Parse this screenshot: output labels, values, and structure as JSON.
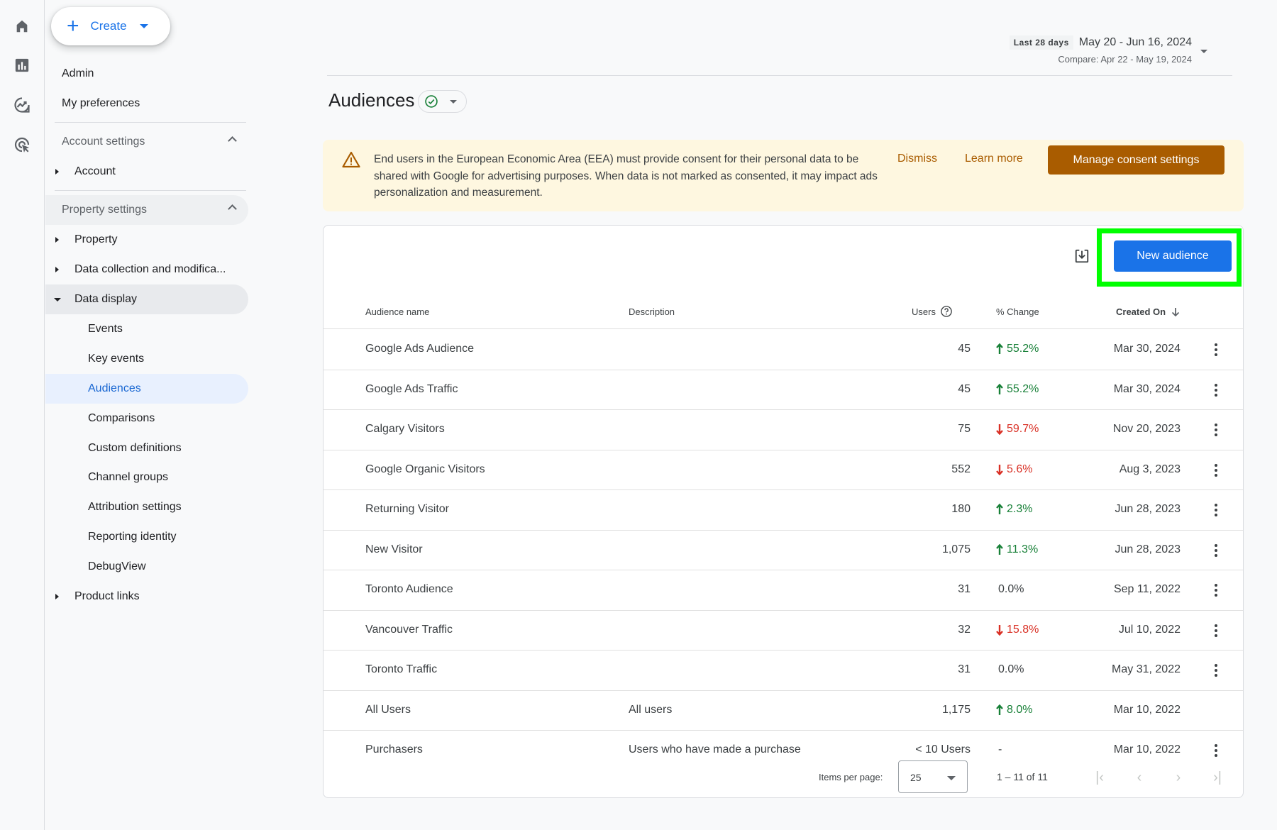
{
  "rail": {
    "icons": [
      "home-icon",
      "reports-icon",
      "explore-icon",
      "advertising-icon"
    ]
  },
  "nav": {
    "create_label": "Create",
    "admin": "Admin",
    "my_preferences": "My preferences",
    "account_settings": "Account settings",
    "account": "Account",
    "property_settings": "Property settings",
    "property": "Property",
    "data_collection": "Data collection and modifica...",
    "data_display": "Data display",
    "events": "Events",
    "key_events": "Key events",
    "audiences": "Audiences",
    "comparisons": "Comparisons",
    "custom_definitions": "Custom definitions",
    "channel_groups": "Channel groups",
    "attribution_settings": "Attribution settings",
    "reporting_identity": "Reporting identity",
    "debugview": "DebugView",
    "product_links": "Product links"
  },
  "date_range": {
    "preset": "Last 28 days",
    "range": "May 20 - Jun 16, 2024",
    "compare": "Compare: Apr 22 - May 19, 2024"
  },
  "page": {
    "title": "Audiences"
  },
  "banner": {
    "message": "End users in the European Economic Area (EEA) must provide consent for their personal data to be shared with Google for advertising purposes. When data is not marked as consented, it may impact ads personalization and measurement.",
    "dismiss": "Dismiss",
    "learn_more": "Learn more",
    "manage": "Manage consent settings"
  },
  "table": {
    "new_audience": "New audience",
    "columns": {
      "name": "Audience name",
      "description": "Description",
      "users": "Users",
      "change": "% Change",
      "created": "Created On"
    },
    "rows": [
      {
        "name": "Google Ads Audience",
        "description": "",
        "users": "45",
        "change": "55.2%",
        "trend": "up",
        "created": "Mar 30, 2024",
        "menu": true
      },
      {
        "name": "Google Ads Traffic",
        "description": "",
        "users": "45",
        "change": "55.2%",
        "trend": "up",
        "created": "Mar 30, 2024",
        "menu": true
      },
      {
        "name": "Calgary Visitors",
        "description": "",
        "users": "75",
        "change": "59.7%",
        "trend": "down",
        "created": "Nov 20, 2023",
        "menu": true
      },
      {
        "name": "Google Organic Visitors",
        "description": "",
        "users": "552",
        "change": "5.6%",
        "trend": "down",
        "created": "Aug 3, 2023",
        "menu": true
      },
      {
        "name": "Returning Visitor",
        "description": "",
        "users": "180",
        "change": "2.3%",
        "trend": "up",
        "created": "Jun 28, 2023",
        "menu": true
      },
      {
        "name": "New Visitor",
        "description": "",
        "users": "1,075",
        "change": "11.3%",
        "trend": "up",
        "created": "Jun 28, 2023",
        "menu": true
      },
      {
        "name": "Toronto Audience",
        "description": "",
        "users": "31",
        "change": "0.0%",
        "trend": "flat",
        "created": "Sep 11, 2022",
        "menu": true
      },
      {
        "name": "Vancouver Traffic",
        "description": "",
        "users": "32",
        "change": "15.8%",
        "trend": "down",
        "created": "Jul 10, 2022",
        "menu": true
      },
      {
        "name": "Toronto Traffic",
        "description": "",
        "users": "31",
        "change": "0.0%",
        "trend": "flat",
        "created": "May 31, 2022",
        "menu": true
      },
      {
        "name": "All Users",
        "description": "All users",
        "users": "1,175",
        "change": "8.0%",
        "trend": "up",
        "created": "Mar 10, 2022",
        "menu": false
      },
      {
        "name": "Purchasers",
        "description": "Users who have made a purchase",
        "users": "< 10 Users",
        "change": "-",
        "trend": "flat",
        "created": "Mar 10, 2022",
        "menu": true
      }
    ],
    "pagination": {
      "items_per_page_label": "Items per page:",
      "items_per_page": "25",
      "range": "1 – 11 of 11"
    }
  },
  "colors": {
    "accent": "#1a73e8",
    "warning": "#a95c00",
    "up": "#188038",
    "down": "#d93025",
    "highlight": "#00ff00"
  }
}
